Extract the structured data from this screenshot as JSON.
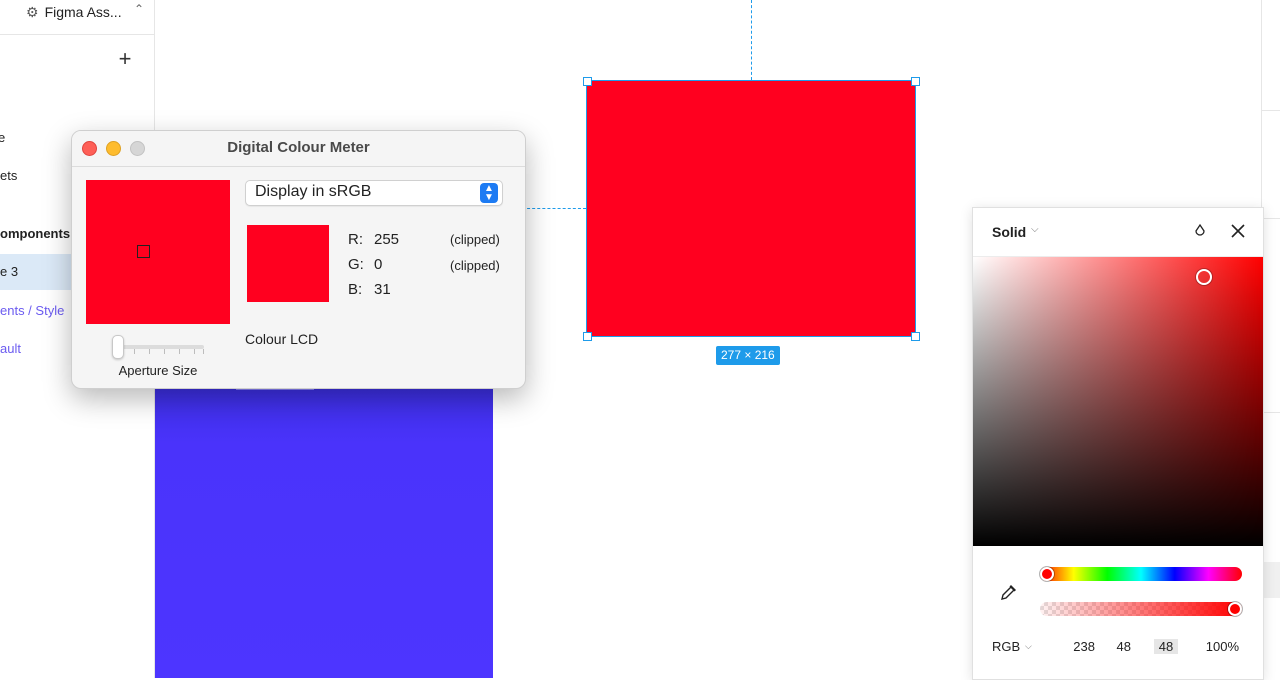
{
  "sidebar": {
    "plugin_name": "Figma Ass...",
    "plugin_icon": "gear-icon",
    "add_label": "+",
    "items": [
      {
        "label": "e"
      },
      {
        "label": "ets"
      },
      {
        "label": "omponents"
      },
      {
        "label": "e 3"
      },
      {
        "label": "ents / Style"
      },
      {
        "label": "ault"
      }
    ]
  },
  "canvas": {
    "selection_size": "277 × 216",
    "selected_fill": "#ff001f",
    "frame_fill": "#4d35ff",
    "accent": "#1e9bea"
  },
  "colour_meter": {
    "title": "Digital Colour Meter",
    "display_mode": "Display in sRGB",
    "aperture_label": "Aperture Size",
    "display_name": "Colour LCD",
    "sample_color": "#ff001f",
    "values": [
      {
        "label": "R:",
        "value": "255",
        "note": "(clipped)"
      },
      {
        "label": "G:",
        "value": "0",
        "note": "(clipped)"
      },
      {
        "label": "B:",
        "value": "31",
        "note": ""
      }
    ]
  },
  "color_picker": {
    "fill_type": "Solid",
    "color_model": "RGB",
    "r": "238",
    "g": "48",
    "b": "48",
    "alpha": "100%",
    "hue_color": "#ff0000"
  }
}
